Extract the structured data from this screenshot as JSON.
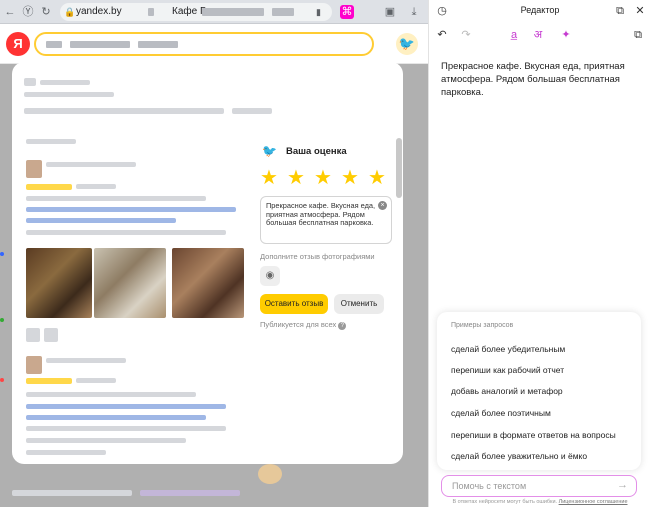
{
  "browser": {
    "url": "yandex.by",
    "tab_title": "Кафе Г"
  },
  "review_form": {
    "title": "Ваша оценка",
    "rating": 5,
    "max_rating": 5,
    "review_text": "Прекрасное кафе. Вкусная еда, приятная атмосфера. Рядом большая бесплатная парковка.",
    "photos_label": "Дополните отзыв фотографиями",
    "submit_label": "Оставить отзыв",
    "cancel_label": "Отменить",
    "public_note": "Публикуется для всех"
  },
  "editor": {
    "title": "Редактор",
    "text": "Прекрасное кафе. Вкусная еда, приятная атмосфера. Рядом большая бесплатная парковка.",
    "examples_header": "Примеры запросов",
    "examples": [
      "сделай более убедительным",
      "перепиши как рабочий отчет",
      "добавь аналогий и метафор",
      "сделай более поэтичным",
      "перепиши в формате ответов на вопросы",
      "сделай более уважительно и ёмко"
    ],
    "input_placeholder": "Помочь с текстом",
    "disclaimer": "В ответах нейросети могут быть ошибки.",
    "disclaimer_link": "Лицензионное соглашение"
  },
  "colors": {
    "accent_yellow": "#ffcc00",
    "editor_accent": "#c53ad0",
    "input_border": "#e38fe8"
  },
  "icons": [
    "back-icon",
    "forward-icon",
    "reload-icon",
    "lock-icon",
    "bookmark-icon",
    "download-icon",
    "extension-icon",
    "history-icon",
    "undo-icon",
    "redo-icon",
    "translate-icon",
    "magic-icon",
    "copy-icon",
    "open-in-new-icon",
    "close-icon",
    "camera-icon",
    "send-icon",
    "star-icon",
    "bird-icon"
  ]
}
